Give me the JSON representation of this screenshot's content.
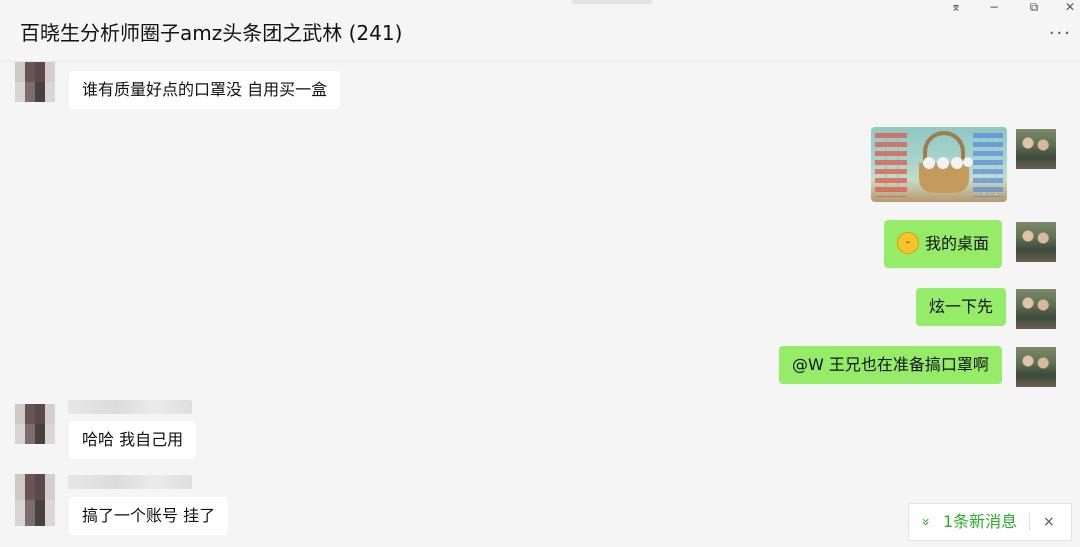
{
  "window": {
    "title": "百晓生分析师圈子amz头条团之武林 (241)",
    "pin_icon": "pin-icon",
    "minimize_label": "−",
    "maximize_label": "⧉",
    "close_label": "✕",
    "more_label": "···"
  },
  "messages": [
    {
      "side": "left",
      "text": "谁有质量好点的口罩没   自用买一盒"
    },
    {
      "side": "right",
      "type": "image",
      "image_description_icon": "desktop-screenshot-thumbnail"
    },
    {
      "side": "right",
      "emoji": "grin-emoji-icon",
      "text": "我的桌面"
    },
    {
      "side": "right",
      "text": "炫一下先"
    },
    {
      "side": "right",
      "text": "@W 王兄也在准备搞口罩啊"
    },
    {
      "side": "left",
      "text": "哈哈   我自己用"
    },
    {
      "side": "left",
      "text": "搞了一个账号  挂了"
    }
  ],
  "new_messages": {
    "chevron": "»",
    "label": "1条新消息",
    "close": "×"
  },
  "colors": {
    "bubble_self": "#95ec69",
    "bubble_other": "#ffffff",
    "background": "#f5f5f5",
    "accent_green": "#2aae2a"
  }
}
